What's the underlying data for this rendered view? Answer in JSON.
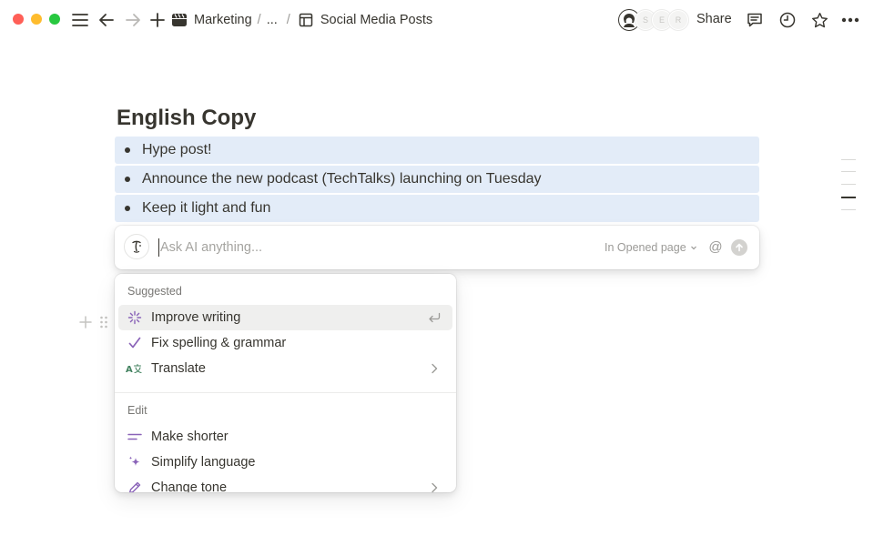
{
  "topbar": {
    "breadcrumbs": [
      {
        "label": "Marketing",
        "icon": "clapperboard-icon"
      },
      {
        "label": "..."
      },
      {
        "label": "Social Media Posts",
        "icon": "database-table-icon"
      }
    ],
    "breadcrumb_separator": "/",
    "avatars": [
      "S",
      "E",
      "R"
    ],
    "share_label": "Share"
  },
  "page": {
    "heading": "English Copy",
    "bullets": [
      "Hype post!",
      "Announce the new podcast (TechTalks) launching on Tuesday",
      "Keep it light and fun"
    ]
  },
  "ai": {
    "placeholder": "Ask AI anything...",
    "context_label": "In Opened page",
    "at_symbol": "@"
  },
  "menu": {
    "sections": [
      {
        "title": "Suggested",
        "items": [
          {
            "label": "Improve writing",
            "icon": "sparkle-burst-icon",
            "trailing": "enter-icon",
            "highlighted": true
          },
          {
            "label": "Fix spelling & grammar",
            "icon": "checkmark-icon"
          },
          {
            "label": "Translate",
            "icon": "translate-icon",
            "trailing": "chevron-right-icon"
          }
        ]
      },
      {
        "title": "Edit",
        "items": [
          {
            "label": "Make shorter",
            "icon": "short-lines-icon"
          },
          {
            "label": "Simplify language",
            "icon": "sparkles-icon"
          },
          {
            "label": "Change tone",
            "icon": "pen-icon",
            "trailing": "chevron-right-icon"
          }
        ]
      }
    ]
  },
  "colors": {
    "selection": "#e3ecf8",
    "accent_purple": "#8a63b8",
    "text": "#37352f",
    "muted": "#9b9a97"
  }
}
